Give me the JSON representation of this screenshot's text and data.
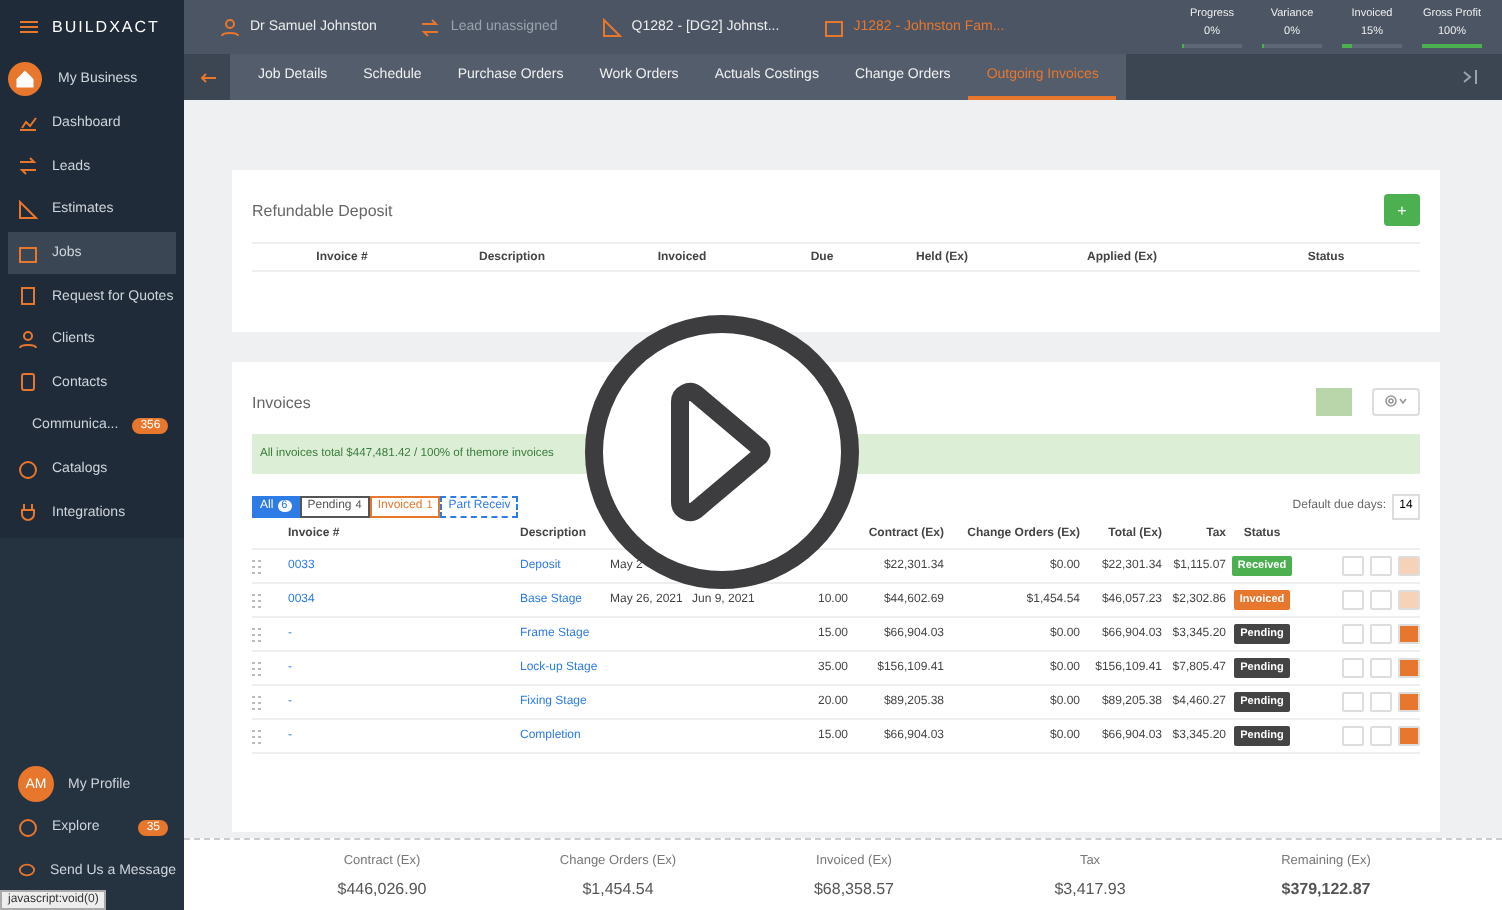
{
  "logo": "BUILDXACT",
  "header": {
    "contact": "Dr Samuel Johnston",
    "lead": "Lead unassigned",
    "quote": "Q1282 - [DG2] Johnst...",
    "job": "J1282 - Johnston Fam..."
  },
  "stats": [
    {
      "label": "Progress",
      "value": "0%",
      "level": 0
    },
    {
      "label": "Variance",
      "value": "0%",
      "level": 0
    },
    {
      "label": "Invoiced",
      "value": "15%",
      "level": 0.15
    },
    {
      "label": "Gross Profit",
      "value": "100%",
      "level": 1
    }
  ],
  "business": {
    "label": "My Business"
  },
  "tabs": [
    {
      "label": "Job Details",
      "selected": false
    },
    {
      "label": "Schedule",
      "selected": false
    },
    {
      "label": "Purchase Orders",
      "selected": false
    },
    {
      "label": "Work Orders",
      "selected": false
    },
    {
      "label": "Actuals Costings",
      "selected": false
    },
    {
      "label": "Change Orders",
      "selected": false
    },
    {
      "label": "Outgoing Invoices",
      "selected": true
    }
  ],
  "sidebar": {
    "items": [
      {
        "label": "Dashboard",
        "selected": false
      },
      {
        "label": "Leads",
        "selected": false
      },
      {
        "label": "Estimates",
        "selected": false
      },
      {
        "label": "Jobs",
        "selected": true
      },
      {
        "label": "Request for Quotes",
        "selected": false
      },
      {
        "label": "Clients",
        "selected": false
      },
      {
        "label": "Contacts",
        "selected": false
      },
      {
        "label": "Communica...",
        "selected": false,
        "badge": "356"
      },
      {
        "label": "Catalogs",
        "selected": false
      },
      {
        "label": "Integrations",
        "selected": false
      }
    ],
    "profile": {
      "initials": "AM",
      "label": "My Profile"
    },
    "bottom_items": [
      {
        "label": "Explore",
        "badge": "35"
      },
      {
        "label": "Send Us a Message"
      }
    ]
  },
  "deposit": {
    "title": "Refundable Deposit",
    "add_label": "+",
    "columns": [
      "Invoice #",
      "Description",
      "Invoiced",
      "Due",
      "Held (Ex)",
      "Applied (Ex)",
      "Status"
    ]
  },
  "invoices": {
    "title": "Invoices",
    "banner": "All invoices total $447,481.42 / 100% of themore invoices",
    "filters": [
      {
        "label": "All",
        "count": "6",
        "selected": true,
        "kind": "all"
      },
      {
        "label": "Pending",
        "count": "4",
        "selected": false,
        "kind": "pending"
      },
      {
        "label": "Invoiced",
        "count": "1",
        "selected": false,
        "kind": "invoiced"
      },
      {
        "label": "Part Receiv",
        "selected": false,
        "kind": "part"
      }
    ],
    "due_days_label": "Default due days:",
    "due_days": "14",
    "columns": {
      "invoice": "Invoice #",
      "description": "Description",
      "contract": "Contract (Ex)",
      "change": "Change Orders (Ex)",
      "total": "Total (Ex)",
      "tax": "Tax",
      "status": "Status"
    },
    "rows": [
      {
        "invoice": "0033",
        "description": "Deposit",
        "date": "May 2",
        "contract": "$22,301.34",
        "change": "$0.00",
        "total": "$22,301.34",
        "tax": "$1,115.07",
        "status": "Received",
        "kind": "received"
      },
      {
        "invoice": "0034",
        "description": "Base Stage",
        "date": "May 26, 2021",
        "due": "Jun 9, 2021",
        "percent": "10.00",
        "contract": "$44,602.69",
        "change": "$1,454.54",
        "total": "$46,057.23",
        "tax": "$2,302.86",
        "status": "Invoiced",
        "kind": "invoiced"
      },
      {
        "invoice": "-",
        "description": "Frame Stage",
        "percent": "15.00",
        "contract": "$66,904.03",
        "change": "$0.00",
        "total": "$66,904.03",
        "tax": "$3,345.20",
        "status": "Pending",
        "kind": "pending"
      },
      {
        "invoice": "-",
        "description": "Lock-up Stage",
        "percent": "35.00",
        "contract": "$156,109.41",
        "change": "$0.00",
        "total": "$156,109.41",
        "tax": "$7,805.47",
        "status": "Pending",
        "kind": "pending"
      },
      {
        "invoice": "-",
        "description": "Fixing Stage",
        "percent": "20.00",
        "contract": "$89,205.38",
        "change": "$0.00",
        "total": "$89,205.38",
        "tax": "$4,460.27",
        "status": "Pending",
        "kind": "pending"
      },
      {
        "invoice": "-",
        "description": "Completion",
        "percent": "15.00",
        "contract": "$66,904.03",
        "change": "$0.00",
        "total": "$66,904.03",
        "tax": "$3,345.20",
        "status": "Pending",
        "kind": "pending"
      }
    ]
  },
  "totals": [
    {
      "label": "Contract (Ex)",
      "value": "$446,026.90"
    },
    {
      "label": "Change Orders (Ex)",
      "value": "$1,454.54"
    },
    {
      "label": "Invoiced (Ex)",
      "value": "$68,358.57"
    },
    {
      "label": "Tax",
      "value": "$3,417.93"
    },
    {
      "label": "Remaining (Ex)",
      "value": "$379,122.87",
      "strong": true
    }
  ],
  "status_bar": "javascript:void(0)"
}
